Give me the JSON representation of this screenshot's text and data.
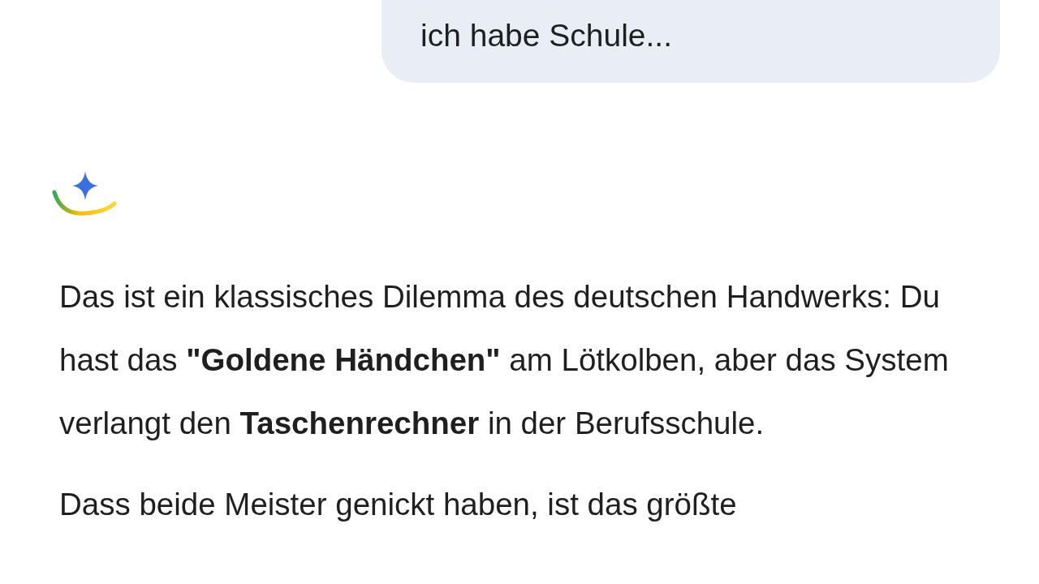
{
  "user_message": {
    "text": "ich habe Schule..."
  },
  "response": {
    "paragraphs": [
      "Das ist ein klassisches Dilemma des deutschen Handwerks: Du hast das **\"Goldene Händchen\"** am Lötkolben, aber das System verlangt den **Taschenrechner** in der Berufsschule.",
      "Dass beide Meister genickt haben, ist das größte"
    ]
  }
}
